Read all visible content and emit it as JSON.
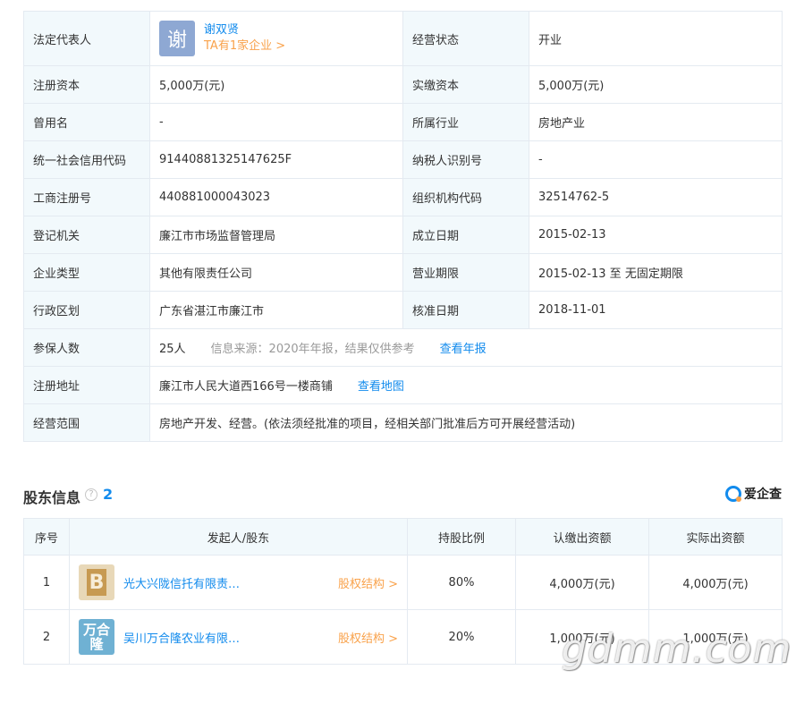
{
  "info": {
    "rows": [
      {
        "l1": "法定代表人",
        "l2": "经营状态",
        "v2": "开业"
      },
      {
        "l1": "注册资本",
        "v1": "5,000万(元)",
        "l2": "实缴资本",
        "v2": "5,000万(元)"
      },
      {
        "l1": "曾用名",
        "v1": "-",
        "l2": "所属行业",
        "v2": "房地产业"
      },
      {
        "l1": "统一社会信用代码",
        "v1": "91440881325147625F",
        "l2": "纳税人识别号",
        "v2": "-"
      },
      {
        "l1": "工商注册号",
        "v1": "440881000043023",
        "l2": "组织机构代码",
        "v2": "32514762-5"
      },
      {
        "l1": "登记机关",
        "v1": "廉江市市场监督管理局",
        "l2": "成立日期",
        "v2": "2015-02-13"
      },
      {
        "l1": "企业类型",
        "v1": "其他有限责任公司",
        "l2": "营业期限",
        "v2": "2015-02-13 至 无固定期限"
      },
      {
        "l1": "行政区划",
        "v1": "广东省湛江市廉江市",
        "l2": "核准日期",
        "v2": "2018-11-01"
      }
    ],
    "rep": {
      "avatar": "谢",
      "name": "谢双贤",
      "link": "TA有1家企业 >"
    },
    "insured": {
      "label": "参保人数",
      "value": "25人",
      "note": "信息来源：2020年年报，结果仅供参考",
      "link": "查看年报"
    },
    "address": {
      "label": "注册地址",
      "value": "廉江市人民大道西166号一楼商铺",
      "link": "查看地图"
    },
    "scope": {
      "label": "经营范围",
      "value": "房地产开发、经营。(依法须经批准的项目，经相关部门批准后方可开展经营活动)"
    }
  },
  "shareholders": {
    "title": "股东信息",
    "help": "?",
    "count": "2",
    "brand": "爱企查",
    "headers": [
      "序号",
      "发起人/股东",
      "持股比例",
      "认缴出资额",
      "实际出资额"
    ],
    "rows": [
      {
        "no": "1",
        "logo": "B",
        "name": "光大兴陇信托有限责…",
        "link": "股权结构 >",
        "ratio": "80%",
        "subscribed": "4,000万(元)",
        "paid": "4,000万(元)"
      },
      {
        "no": "2",
        "logo": "万合隆",
        "name": "吴川万合隆农业有限…",
        "link": "股权结构 >",
        "ratio": "20%",
        "subscribed": "1,000万(元)",
        "paid": "1,000万(元)"
      }
    ]
  },
  "watermark": "gdmm.com"
}
